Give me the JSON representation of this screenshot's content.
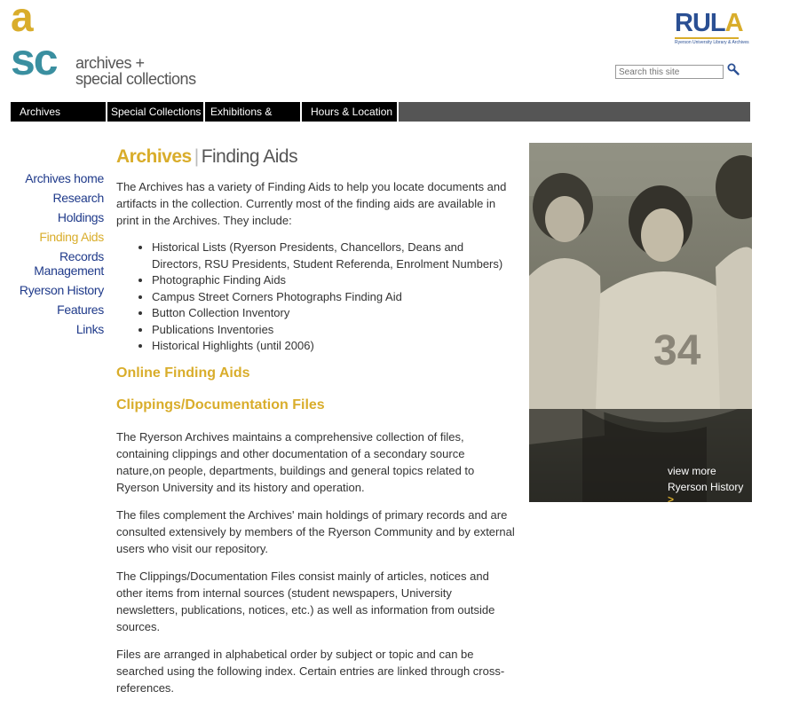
{
  "logo": {
    "letter_a": "a",
    "letters_sc": "sc",
    "line1": "archives +",
    "line2": "special collections"
  },
  "rula": {
    "r": "RUL",
    "a": "A",
    "subtitle": "Ryerson University Library & Archives"
  },
  "search": {
    "placeholder": "Search this site",
    "icon": "search-icon"
  },
  "nav": {
    "tabs": [
      "Archives",
      "Special Collections",
      "Exhibitions & Events",
      "Hours & Location"
    ]
  },
  "sidenav": {
    "items": [
      {
        "label": "Archives home"
      },
      {
        "label": "Research"
      },
      {
        "label": "Holdings"
      },
      {
        "label": "Finding Aids",
        "active": true
      },
      {
        "label": "Records Management"
      },
      {
        "label": "Ryerson History"
      },
      {
        "label": "Features"
      },
      {
        "label": "Links"
      }
    ]
  },
  "main": {
    "title_section": "Archives",
    "title_sep": "|",
    "title_page": "Finding Aids",
    "intro": "The Archives has a variety of Finding Aids to help you locate documents and artifacts in the collection. Currently most of the finding aids are available in print in the Archives. They include:",
    "list": [
      "Historical Lists (Ryerson Presidents, Chancellors, Deans and Directors, RSU Presidents, Student Referenda, Enrolment Numbers)",
      "Photographic Finding Aids",
      "Campus Street Corners Photographs Finding Aid",
      "Button Collection Inventory",
      "Publications Inventories",
      "Historical Highlights (until 2006)"
    ],
    "heading1": "Online Finding Aids",
    "heading2": "Clippings/Documentation Files",
    "paragraphs": [
      "The Ryerson Archives maintains a comprehensive collection of files, containing clippings and other documentation of a secondary source nature,on people, departments, buildings and general topics related to Ryerson University and its history and operation.",
      "The files complement the Archives' main holdings of primary records and are consulted extensively by members of the Ryerson Community and by external users who visit our repository.",
      "The Clippings/Documentation Files consist mainly of articles, notices and other items from internal sources (student newspapers, University newsletters, publications, notices, etc.) as well as information from outside sources.",
      "Files are arranged in alphabetical order by subject or topic and can be searched using the following index. Certain entries are linked through cross-references."
    ]
  },
  "photo": {
    "caption1": "view more",
    "caption2": "Ryerson History",
    "chevron": ">"
  },
  "colors": {
    "gold": "#d9ad2b",
    "teal": "#3a8fa0",
    "link_blue": "#1f3a8a",
    "nav_black": "#000000",
    "nav_grey": "#555555"
  }
}
